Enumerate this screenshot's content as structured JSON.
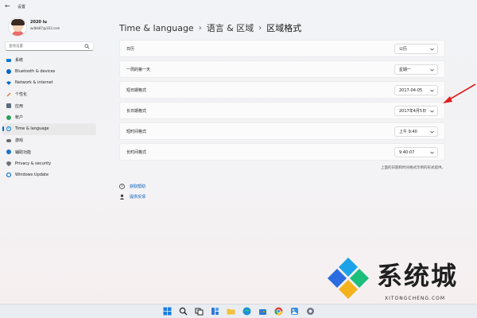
{
  "window": {
    "back_icon": "back-arrow-icon",
    "title": "设置"
  },
  "profile": {
    "name": "2020 lu",
    "email": "wdbb87@163.com"
  },
  "search": {
    "placeholder": "查找设置",
    "icon": "search-icon"
  },
  "nav": {
    "items": [
      {
        "label": "系统",
        "icon": "system-icon",
        "color": "#0078d4"
      },
      {
        "label": "Bluetooth & devices",
        "icon": "bluetooth-icon",
        "color": "#0067c0"
      },
      {
        "label": "Network & internet",
        "icon": "network-icon",
        "color": "#0a66c2"
      },
      {
        "label": "个性化",
        "icon": "personalization-icon",
        "color": "#e07b39"
      },
      {
        "label": "应用",
        "icon": "apps-icon",
        "color": "#5a6b7b"
      },
      {
        "label": "帐户",
        "icon": "accounts-icon",
        "color": "#2aa15a"
      },
      {
        "label": "Time & language",
        "icon": "time-language-icon",
        "color": "#1b8ad8"
      },
      {
        "label": "游戏",
        "icon": "gaming-icon",
        "color": "#6c6c6c"
      },
      {
        "label": "辅助功能",
        "icon": "accessibility-icon",
        "color": "#1a73c9"
      },
      {
        "label": "Privacy & security",
        "icon": "privacy-icon",
        "color": "#6a6f78"
      },
      {
        "label": "Windows Update",
        "icon": "windows-update-icon",
        "color": "#0b6fc6"
      }
    ],
    "active_index": 6
  },
  "breadcrumb": {
    "parts": [
      "Time & language",
      "语言 & 区域",
      "区域格式"
    ],
    "separator": "›"
  },
  "settings": {
    "rows": [
      {
        "label": "日历",
        "value": "公历"
      },
      {
        "label": "一周的第一天",
        "value": "星期一"
      },
      {
        "label": "短日期格式",
        "value": "2017-04-05"
      },
      {
        "label": "长日期格式",
        "value": "2017年4月5日"
      },
      {
        "label": "短时间格式",
        "value": "上午 9:40"
      },
      {
        "label": "长时间格式",
        "value": "9:40:07"
      }
    ],
    "footnote": "上面的日期和时间格式示例的形式提供。"
  },
  "links": [
    {
      "label": "获取帮助",
      "icon": "help-icon"
    },
    {
      "label": "提供反馈",
      "icon": "feedback-icon"
    }
  ],
  "annotation": {
    "color": "#e02020",
    "icon": "red-arrow-pointer"
  },
  "watermark": {
    "text": "系统城",
    "subtext": "XITONGCHENG.COM",
    "logo": "diamond-logo-icon",
    "colors": [
      "#1aa3e8",
      "#2b6de0",
      "#1bbf7a",
      "#f2b31c"
    ]
  },
  "taskbar": {
    "icons": [
      "windows-start-icon",
      "search-icon",
      "task-view-icon",
      "widgets-icon",
      "file-explorer-icon",
      "edge-icon",
      "store-icon",
      "chrome-icon",
      "photos-icon",
      "settings-icon"
    ]
  }
}
